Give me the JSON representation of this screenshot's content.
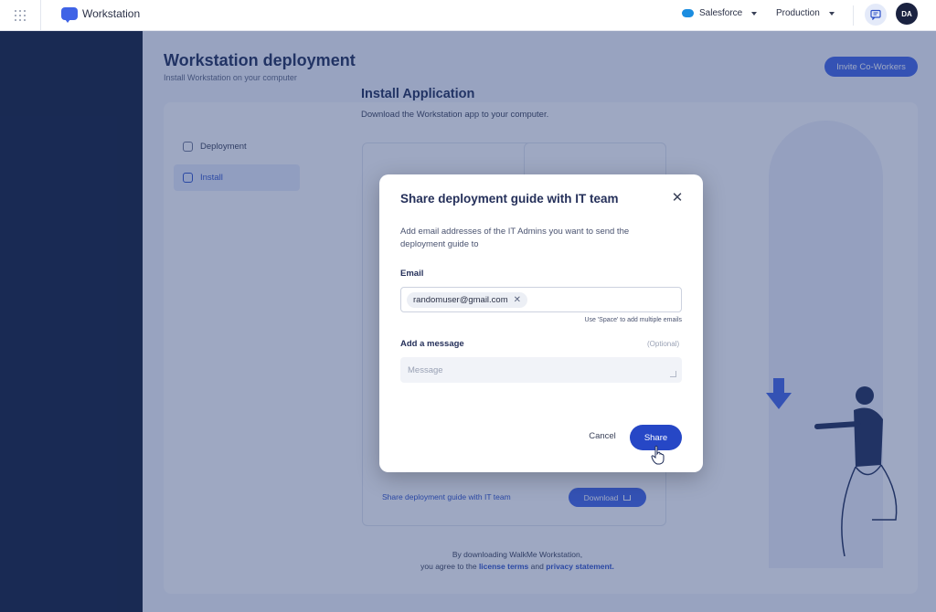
{
  "topbar": {
    "app_name": "Workstation",
    "system_name": "Salesforce",
    "environment": "Production",
    "avatar_initials": "DA"
  },
  "page": {
    "title": "Workstation deployment",
    "subtitle": "Install Workstation on your computer",
    "invite_button": "Invite Co-Workers"
  },
  "sidebar": {
    "items": [
      {
        "label": "Deployment",
        "icon": "user-settings-icon"
      },
      {
        "label": "Install",
        "icon": "install-icon",
        "active": true
      }
    ]
  },
  "install": {
    "title": "Install Application",
    "subtitle": "Download the Workstation app to your computer.",
    "share_link": "Share deployment guide with IT team",
    "download_button": "Download",
    "legal_line1": "By downloading WalkMe Workstation,",
    "legal_prefix": "you agree to the",
    "license_link": "license terms",
    "legal_and": "and",
    "privacy_link": "privacy statement."
  },
  "modal": {
    "title": "Share deployment guide with IT team",
    "description": "Add email addresses of the IT Admins you want to send the deployment guide to",
    "email_label": "Email",
    "email_chip": "randomuser@gmail.com",
    "email_hint": "Use 'Space' to add multiple emails",
    "message_label": "Add a message",
    "message_optional": "(Optional)",
    "message_placeholder": "Message",
    "cancel_button": "Cancel",
    "share_button": "Share"
  },
  "colors": {
    "accent": "#3f63e6",
    "share_button": "#2647c6",
    "leftnav": "#0d1a36"
  }
}
